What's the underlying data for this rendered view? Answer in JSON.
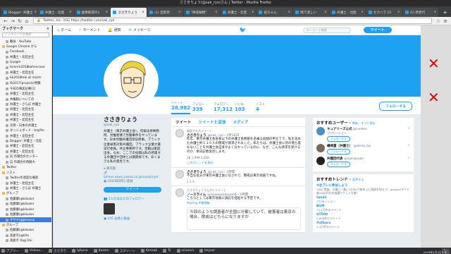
{
  "window": {
    "title": "ささきりょう(@sak_ryo)さん | Twitter - Mozilla Firefox"
  },
  "tabs": [
    {
      "label": "Blogger: 弁護士",
      "active": false
    },
    {
      "label": "弁護士 - 北陸",
      "active": false
    },
    {
      "label": "画像取得の1",
      "active": false
    },
    {
      "label": "ささきりょう",
      "active": true
    },
    {
      "label": "(1) 自民党",
      "active": false
    },
    {
      "label": "\"徴収納税\"",
      "active": false
    },
    {
      "label": "弁護士 - 北陸",
      "active": false
    },
    {
      "label": "処ちゃん",
      "active": false
    },
    {
      "label": "暇で泥しい",
      "active": false
    },
    {
      "label": "弁護士 - 北陸",
      "active": false
    },
    {
      "label": "セクハラ 25",
      "active": false
    },
    {
      "label": "(1) 新世代",
      "active": false
    }
  ],
  "navbar": {
    "url": "https://twitter.com/sak_ryo",
    "lock_label": "Twitter, Inc. (US)"
  },
  "sidebar": {
    "title": "ブックマーク",
    "search_placeholder": "ブックマークを検索",
    "items": [
      {
        "label": "動画 - YouTube",
        "kind": "item",
        "selected": false
      },
      {
        "label": "Google Chrome から",
        "kind": "folder",
        "selected": false
      },
      {
        "label": "Facebook",
        "kind": "item",
        "selected": false
      },
      {
        "label": "弁護士・北陸主任",
        "kind": "item",
        "selected": false
      },
      {
        "label": "Google",
        "kind": "item",
        "selected": false
      },
      {
        "label": "tonerin2018kohencooo",
        "kind": "item",
        "selected": false
      },
      {
        "label": "弁護士・北陸主任",
        "kind": "item",
        "selected": false
      },
      {
        "label": "kb2018tele at mozm",
        "kind": "item",
        "selected": false
      },
      {
        "label": "fb2017/projects/特集",
        "kind": "item",
        "selected": false
      },
      {
        "label": "今日の事実記事[2]",
        "kind": "item",
        "selected": false
      },
      {
        "label": "弁護士・北陸主任",
        "kind": "item",
        "selected": false
      },
      {
        "label": "共権税についての",
        "kind": "item",
        "selected": false
      },
      {
        "label": "弁護士・さらば 弁護士",
        "kind": "item",
        "selected": false
      },
      {
        "label": "弁護士・北陸主任",
        "kind": "item",
        "selected": false
      },
      {
        "label": "弁護士・北陸主任",
        "kind": "item",
        "selected": false
      },
      {
        "label": "弁護士・北陸主任",
        "kind": "item",
        "selected": false
      },
      {
        "label": "次男・日本の弁護士",
        "kind": "item",
        "selected": false
      },
      {
        "label": "ダッシュボード - telyPer",
        "kind": "item",
        "selected": false
      },
      {
        "label": "弁護士・北陸主任",
        "kind": "item",
        "selected": false
      },
      {
        "label": "Blogger: 弁護士・北陸",
        "kind": "item",
        "selected": false
      },
      {
        "label": "弁護士・北陸主任",
        "kind": "item",
        "selected": false
      },
      {
        "label": "弁護士・北陸主任",
        "kind": "item",
        "selected": false
      },
      {
        "label": "向 作場合のセンター",
        "kind": "item",
        "selected": false
      },
      {
        "label": "向 作場合の時間大",
        "kind": "item",
        "selected": false
      },
      {
        "label": "Twitter",
        "kind": "folder",
        "selected": false
      },
      {
        "label": "リスト",
        "kind": "folder",
        "selected": false
      },
      {
        "label": "Twitterの高度な検索",
        "kind": "item",
        "selected": false
      },
      {
        "label": "弁護士・北陸主任",
        "kind": "item",
        "selected": false
      },
      {
        "label": "弁護士・さらば 弁護士",
        "kind": "item",
        "selected": false
      },
      {
        "label": "グループ",
        "kind": "folder",
        "selected": false
      },
      {
        "label": "佐藤康(@kikuker",
        "kind": "item",
        "selected": false
      },
      {
        "label": "佐藤康(@kikuker",
        "kind": "item",
        "selected": false
      },
      {
        "label": "佐藤康(@kikuker",
        "kind": "item",
        "selected": false
      },
      {
        "label": "佐藤康(@kikuker",
        "kind": "item",
        "selected": false
      },
      {
        "label": "ササキ(@jshensu",
        "kind": "item",
        "selected": true
      },
      {
        "label": "グループ",
        "kind": "folder",
        "selected": false
      },
      {
        "label": "佐藤康(@kikuker",
        "kind": "item",
        "selected": false
      },
      {
        "label": "高倉市(@kita",
        "kind": "item",
        "selected": false
      },
      {
        "label": "高倉市 Yogi Oni",
        "kind": "item",
        "selected": false
      }
    ]
  },
  "twitter_nav": {
    "home": "ホーム",
    "moments": "モーメント",
    "notifications": "通知",
    "messages": "メッセージ",
    "search_placeholder": "キーワード検索",
    "tweet_button": "ツイート"
  },
  "profile": {
    "name": "ささきりょう",
    "handle": "@sak_ryo",
    "bio": "弁護士（東京弁護士会）。旬報法律事務所。労働者側で労働事件をやっています。日本労働弁護団常任幹事。ブラック企業被害対策弁護団。ブラック企業大賞実行委員。共立事務所です。活動は家庭出身。なお、ここでの投稿は私の所属する弁護団や団体とは無関係です。あくまでも私の意見です。",
    "location": "東京都",
    "website": "lplines.news.yahoo.co.jp/sasakiryo/",
    "joined": "2010年8月に登録",
    "tweet_to_button": "ツイート",
    "followers_you_know": "1人のあなたのフォロワー",
    "media_label": "155 画像と動画"
  },
  "stats": [
    {
      "label": "ツイート",
      "value": "28,982",
      "active": true
    },
    {
      "label": "フォロー",
      "value": "339",
      "active": false
    },
    {
      "label": "フォロワー",
      "value": "17,312",
      "active": false
    },
    {
      "label": "いいね",
      "value": "103",
      "active": false
    },
    {
      "label": "リスト",
      "value": "4",
      "active": false
    }
  ],
  "follow_button": "フォローする",
  "timeline": {
    "tabs": [
      "ツイート",
      "ツイートと返信",
      "メディア"
    ],
    "tweets": [
      {
        "pinned": "固定されたツイート",
        "name": "ささきりょう",
        "handle": "@sak_ryo・4月26日",
        "text": "昨年、東京弁護士会会長以下の弁護士会幹部を名乗る仮想の申立てで、私を含めた弁護士約５１０人の懲戒が請求されました。私たちは、弁護士会に何の落ち度もないことを弁護士会自身がよく分かっているのに、なぜ、こんな請求を受けるのか、本日記者会見します。",
        "actions": "28   1,999   1,456",
        "thread": "このスレッドを表示"
      },
      {
        "pinned": "",
        "name": "ささきりょう",
        "handle": "@sak_ryo・1時間",
        "text": "不当な処分が東京弁護士会になされて、懲戒は東京地裁ですね。",
        "actions": "1   1   3",
        "thread": ""
      },
      {
        "pinned": "ささきりょうさんがリツイート",
        "name": "ノースライム",
        "handle": "@noooooooooon6・1時間",
        "text": "こちらとしては東京地裁に訴訟を提起する予定です。",
        "actions": "",
        "thread": "",
        "link": "#peing #質問箱",
        "image_text": "今回のような調査者が全国に分散していて、被害者は東京の場合、懲戒はどちらになりますか"
      }
    ]
  },
  "who_to_follow": {
    "title": "おすすめユーザー",
    "refresh": "更新・すべて表示",
    "users": [
      {
        "name": "キュアリーズ公式",
        "handle": "@curelies",
        "sub": "プロモーション",
        "button": "フォローする",
        "color": "#4a90c2"
      },
      {
        "name": "嶋崎量（弁護士）",
        "handle": "@shima_ryo",
        "sub": "",
        "button": "フォローする",
        "color": "#7a6a5a"
      },
      {
        "name": "弁護団代表",
        "handle": "@asahiaoyaki",
        "sub": "",
        "button": "フォローする",
        "color": "#222222"
      }
    ]
  },
  "trends": {
    "title": "おすすめトレンド",
    "change": "変更する",
    "items": [
      {
        "tag": "#全プレに参加しよう",
        "sub": "GWに実施。五巣に一番にTikTokで総合上に高級を知ろう！Amazonギフト券2000円分を抽選でゲット可能！"
      },
      {
        "tag": "Gmail",
        "sub": "プロモーション"
      },
      {
        "tag": "BGM",
        "sub": "13.2万件のツイート"
      },
      {
        "tag": "GT500",
        "sub": "3,658件のツイート"
      },
      {
        "tag": "#afbara",
        "sub": "1.4万件のツイート"
      }
    ]
  },
  "taskbar": {
    "items": [
      "アプリー",
      "Videos...",
      "ささきり",
      "Iphone",
      "Kazam",
      "スクリーン",
      "Kensok",
      "Ts",
      "scissors",
      "keyser"
    ],
    "clock_time": "19:17",
    "clock_date": "2018年5月4日金曜日"
  },
  "colors": {
    "twitter_blue": "#1da1f2",
    "link_blue": "#1b95e0",
    "selected_bookmark": "#3b7dd8"
  }
}
